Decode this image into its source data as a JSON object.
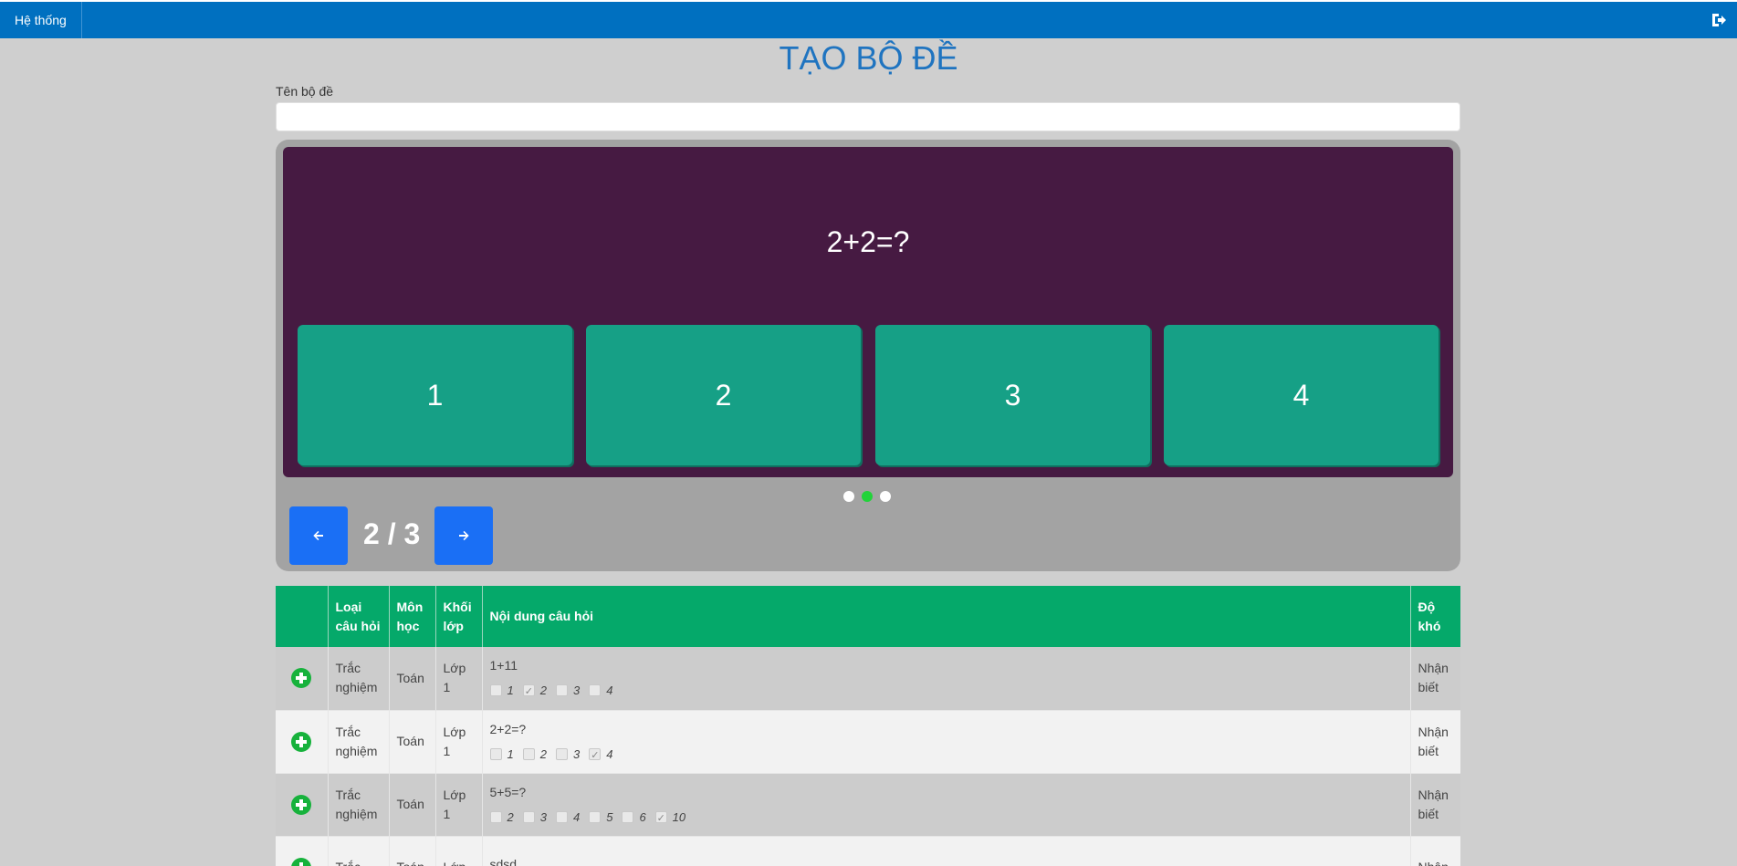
{
  "nav": {
    "brand": "Hệ thống",
    "logout_icon": "logout-icon"
  },
  "title": "TẠO BỘ ĐỀ",
  "form": {
    "name_label": "Tên bộ đề",
    "name_value": "",
    "name_placeholder": ""
  },
  "preview": {
    "question": "2+2=?",
    "answers": [
      "1",
      "2",
      "3",
      "4"
    ],
    "counter": "2 / 3",
    "dots": {
      "total": 3,
      "active_index": 1
    },
    "colors": {
      "slide_bg": "#461a42",
      "answer_bg": "#16a086",
      "active_dot": "#22d33a",
      "nav_button": "#1a6ff5"
    }
  },
  "table": {
    "headers": [
      "",
      "Loại câu hỏi",
      "Môn học",
      "Khối lớp",
      "Nội dung câu hỏi",
      "Độ khó"
    ],
    "rows": [
      {
        "type": "Trắc nghiệm",
        "subject": "Toán",
        "grade": "Lớp 1",
        "content": "1+11",
        "options": [
          {
            "label": "1",
            "checked": false
          },
          {
            "label": "2",
            "checked": true
          },
          {
            "label": "3",
            "checked": false
          },
          {
            "label": "4",
            "checked": false
          }
        ],
        "difficulty": "Nhận biết"
      },
      {
        "type": "Trắc nghiệm",
        "subject": "Toán",
        "grade": "Lớp 1",
        "content": "2+2=?",
        "options": [
          {
            "label": "1",
            "checked": false
          },
          {
            "label": "2",
            "checked": false
          },
          {
            "label": "3",
            "checked": false
          },
          {
            "label": "4",
            "checked": true
          }
        ],
        "difficulty": "Nhận biết"
      },
      {
        "type": "Trắc nghiệm",
        "subject": "Toán",
        "grade": "Lớp 1",
        "content": "5+5=?",
        "options": [
          {
            "label": "2",
            "checked": false
          },
          {
            "label": "3",
            "checked": false
          },
          {
            "label": "4",
            "checked": false
          },
          {
            "label": "5",
            "checked": false
          },
          {
            "label": "6",
            "checked": false
          },
          {
            "label": "10",
            "checked": true
          }
        ],
        "difficulty": "Nhận biết"
      },
      {
        "type": "Trắc",
        "subject": "Toán",
        "grade": "Lớp",
        "content": "sdsd",
        "options": [],
        "difficulty": "Nhận"
      }
    ]
  }
}
